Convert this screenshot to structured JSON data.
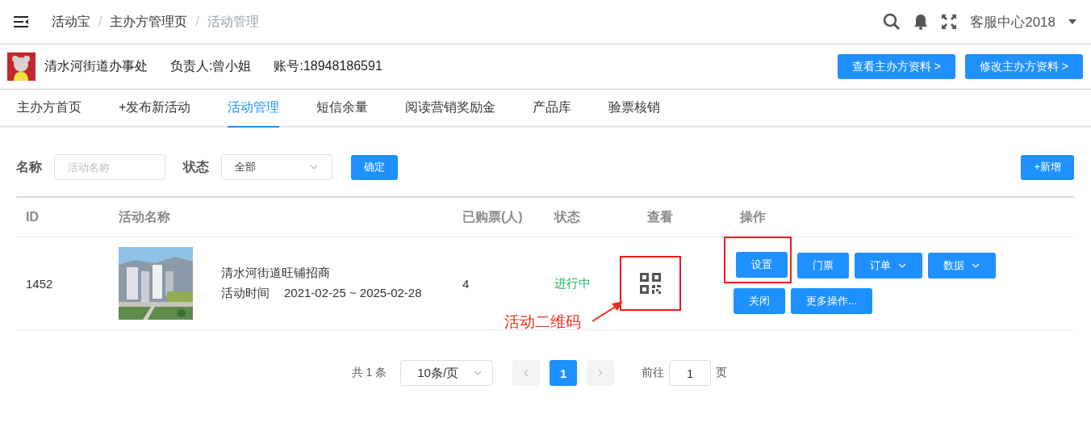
{
  "breadcrumb": [
    {
      "label": "活动宝",
      "current": false
    },
    {
      "label": "主办方管理页",
      "current": false
    },
    {
      "label": "活动管理",
      "current": true
    }
  ],
  "breadcrumb_separator": "/",
  "header": {
    "user": "客服中心2018"
  },
  "organizer": {
    "name": "清水河街道办事处",
    "contact": "负责人:曾小姐",
    "account": "账号:18948186591",
    "buttons": [
      "查看主办方资料 >",
      "修改主办方资料 >"
    ]
  },
  "tabs": [
    {
      "label": "主办方首页",
      "selected": false
    },
    {
      "label": "+发布新活动",
      "selected": false
    },
    {
      "label": "活动管理",
      "selected": true
    },
    {
      "label": "短信余量",
      "selected": false
    },
    {
      "label": "阅读营销奖励金",
      "selected": false
    },
    {
      "label": "产品库",
      "selected": false
    },
    {
      "label": "验票核销",
      "selected": false
    }
  ],
  "filters": {
    "name_label": "名称",
    "name_placeholder": "活动名称",
    "status_label": "状态",
    "status_value": "全部",
    "confirm": "确定",
    "add": "+新增"
  },
  "table": {
    "columns": [
      "ID",
      "活动名称",
      "已购票(人)",
      "状态",
      "查看",
      "操作"
    ],
    "rows": [
      {
        "id": "1452",
        "title": "清水河街道旺铺招商",
        "time_label": "活动时间",
        "time": "2021-02-25 ~ 2025-02-28",
        "bought": "4",
        "status": "进行中",
        "actions": [
          {
            "label": "设置",
            "dropdown": false,
            "highlighted": true
          },
          {
            "label": "门票",
            "dropdown": false,
            "highlighted": false
          },
          {
            "label": "订单",
            "dropdown": true,
            "highlighted": false
          },
          {
            "label": "数据",
            "dropdown": true,
            "highlighted": false
          },
          {
            "label": "关闭",
            "dropdown": false,
            "highlighted": false
          },
          {
            "label": "更多操作...",
            "dropdown": false,
            "highlighted": false
          }
        ],
        "qr_highlighted": true,
        "annotation": "活动二维码"
      }
    ]
  },
  "pagination": {
    "total": "共 1 条",
    "page_size": "10条/页",
    "pages": [
      {
        "label": "1",
        "selected": true
      }
    ],
    "prev_disabled": true,
    "next_disabled": true,
    "goto_label": "前往",
    "goto_value": "1",
    "goto_suffix": "页"
  }
}
